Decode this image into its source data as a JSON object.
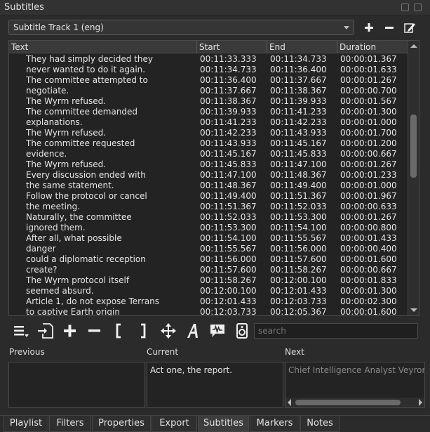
{
  "window": {
    "title": "Subtitles"
  },
  "track": {
    "selected": "Subtitle Track 1 (eng)"
  },
  "table": {
    "columns": [
      "Text",
      "Start",
      "End",
      "Duration"
    ],
    "rows": [
      [
        "They had simply decided they",
        "00:11:33.333",
        "00:11:34.733",
        "00:00:01.367"
      ],
      [
        "never wanted to do it again.",
        "00:11:34.733",
        "00:11:36.400",
        "00:00:01.633"
      ],
      [
        "The committee attempted to",
        "00:11:36.400",
        "00:11:37.667",
        "00:00:01.267"
      ],
      [
        "negotiate.",
        "00:11:37.667",
        "00:11:38.367",
        "00:00:00.700"
      ],
      [
        "The Wyrm refused.",
        "00:11:38.367",
        "00:11:39.933",
        "00:00:01.567"
      ],
      [
        "The committee demanded",
        "00:11:39.933",
        "00:11:41.233",
        "00:00:01.300"
      ],
      [
        "explanations.",
        "00:11:41.233",
        "00:11:42.233",
        "00:00:01.000"
      ],
      [
        "The Wyrm refused.",
        "00:11:42.233",
        "00:11:43.933",
        "00:00:01.700"
      ],
      [
        "The committee requested",
        "00:11:43.933",
        "00:11:45.167",
        "00:00:01.200"
      ],
      [
        "evidence.",
        "00:11:45.167",
        "00:11:45.833",
        "00:00:00.667"
      ],
      [
        "The Wyrm refused.",
        "00:11:45.833",
        "00:11:47.100",
        "00:00:01.267"
      ],
      [
        "Every discussion ended with",
        "00:11:47.100",
        "00:11:48.367",
        "00:00:01.233"
      ],
      [
        "the same statement.",
        "00:11:48.367",
        "00:11:49.400",
        "00:00:01.000"
      ],
      [
        "Follow the protocol or cancel",
        "00:11:49.400",
        "00:11:51.367",
        "00:00:01.967"
      ],
      [
        "the meeting.",
        "00:11:51.367",
        "00:11:52.033",
        "00:00:00.633"
      ],
      [
        "Naturally, the committee",
        "00:11:52.033",
        "00:11:53.300",
        "00:00:01.267"
      ],
      [
        "ignored them.",
        "00:11:53.300",
        "00:11:54.100",
        "00:00:00.800"
      ],
      [
        "After all, what possible",
        "00:11:54.100",
        "00:11:55.567",
        "00:00:01.433"
      ],
      [
        "danger",
        "00:11:55.567",
        "00:11:56.000",
        "00:00:00.400"
      ],
      [
        "could a diplomatic reception",
        "00:11:56.000",
        "00:11:57.600",
        "00:00:01.600"
      ],
      [
        "create?",
        "00:11:57.600",
        "00:11:58.267",
        "00:00:00.667"
      ],
      [
        "The Wyrm protocol itself",
        "00:11:58.267",
        "00:12:00.100",
        "00:00:01.833"
      ],
      [
        "seemed absurd.",
        "00:12:00.100",
        "00:12:01.433",
        "00:00:01.300"
      ],
      [
        "Article 1, do not expose Terrans",
        "00:12:01.433",
        "00:12:03.733",
        "00:00:02.300"
      ],
      [
        "to captive Earth origin",
        "00:12:03.733",
        "00:12:05.367",
        "00:00:01.600"
      ]
    ]
  },
  "search": {
    "placeholder": "search"
  },
  "preview": {
    "previous_label": "Previous",
    "current_label": "Current",
    "next_label": "Next",
    "previous_text": "",
    "current_text": "Act one, the report.",
    "next_text": "Chief Intelligence Analyst Veyron"
  },
  "tabs": [
    "Playlist",
    "Filters",
    "Properties",
    "Export",
    "Subtitles",
    "Markers",
    "Notes"
  ],
  "active_tab": "Subtitles",
  "colors": {
    "background": "#2b2b2b",
    "table_bg": "#232323",
    "text": "#e6e6e6",
    "next_text": "#8a8a8a"
  }
}
